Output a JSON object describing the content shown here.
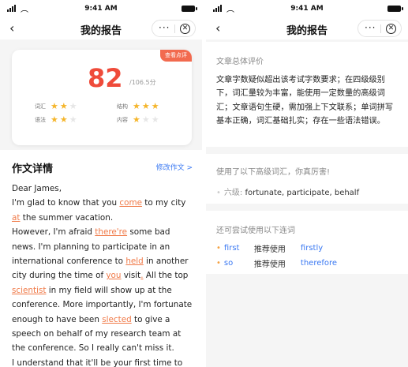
{
  "status": {
    "time": "9:41 AM"
  },
  "nav": {
    "back": "‹",
    "title": "我的报告",
    "more": "···",
    "close": "✕"
  },
  "left": {
    "badge": "查看点评",
    "score": "82",
    "total": "/106.5分",
    "ratings": [
      {
        "label": "词汇",
        "stars": 2
      },
      {
        "label": "结构",
        "stars": 3
      },
      {
        "label": "语法",
        "stars": 2
      },
      {
        "label": "内容",
        "stars": 1
      }
    ],
    "section_title": "作文详情",
    "edit_link": "修改作文 >",
    "essay_lines": [
      [
        {
          "t": "Dear James,"
        }
      ],
      [
        {
          "t": "I'm glad to know that you "
        },
        {
          "t": "come",
          "e": true
        },
        {
          "t": " to my city"
        }
      ],
      [
        {
          "t": "at",
          "e": true
        },
        {
          "t": " the summer vacation."
        }
      ],
      [
        {
          "t": "However, I'm afraid "
        },
        {
          "t": "there're",
          "e": true
        },
        {
          "t": " some bad"
        }
      ],
      [
        {
          "t": "news. I'm planning to participate in an"
        }
      ],
      [
        {
          "t": "international conference to "
        },
        {
          "t": "held",
          "e": true
        },
        {
          "t": " in another"
        }
      ],
      [
        {
          "t": "city during the time of "
        },
        {
          "t": "you",
          "e": true
        },
        {
          "t": " visit"
        },
        {
          "t": ".",
          "e": true
        },
        {
          "t": " All the top"
        }
      ],
      [
        {
          "t": "scientist",
          "e": true
        },
        {
          "t": " in my field will show up at the"
        }
      ],
      [
        {
          "t": "conference. More importantly, I'm fortunate"
        }
      ],
      [
        {
          "t": "enough to have been "
        },
        {
          "t": "slected",
          "e": true
        },
        {
          "t": " to give a"
        }
      ],
      [
        {
          "t": "speech on behalf of my research team at"
        }
      ],
      [
        {
          "t": "the conference. So I really can't miss it."
        }
      ],
      [
        {
          "t": "I understand that it'll be your first time to"
        }
      ]
    ]
  },
  "right": {
    "overall_title": "文章总体评价",
    "overall_text": "文章字数疑似超出该考试字数要求；在四级级别下，词汇量较为丰富，能使用一定数量的高级词汇；文章语句生硬，需加强上下文联系；单词拼写基本正确，词汇基础扎实；存在一些语法错误。",
    "advanced_title": "使用了以下高级词汇，你真厉害!",
    "advanced_prefix": "六级:",
    "advanced_words": "fortunate, participate, behalf",
    "conn_title": "还可尝试使用以下连词",
    "connectors": [
      {
        "word": "first",
        "mid": "推荐使用",
        "alt": "firstly"
      },
      {
        "word": "so",
        "mid": "推荐使用",
        "alt": "therefore"
      }
    ]
  },
  "colors": {
    "accent_red": "#ef4b3a",
    "error_orange": "#f07a48",
    "link_blue": "#3a78f2",
    "star_gold": "#f5b52a"
  }
}
